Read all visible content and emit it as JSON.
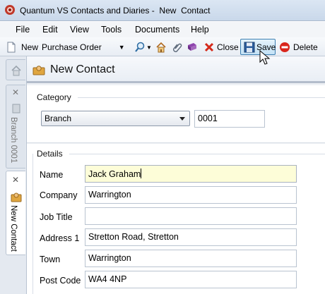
{
  "window": {
    "title": "Quantum VS Contacts and Diaries -  New  Contact"
  },
  "menu": {
    "file": "File",
    "edit": "Edit",
    "view": "View",
    "tools": "Tools",
    "documents": "Documents",
    "help": "Help"
  },
  "toolbar": {
    "new_label": "New",
    "purchase_order": "Purchase Order",
    "close_label": "Close",
    "save_label": "Save",
    "delete_label": "Delete"
  },
  "tabs": [
    {
      "label": "Branch 0001"
    },
    {
      "label": "New Contact"
    }
  ],
  "header": {
    "title": "New Contact"
  },
  "category": {
    "section_label": "Category",
    "dropdown_value": "Branch",
    "code_value": "0001"
  },
  "details": {
    "section_label": "Details",
    "fields": [
      {
        "label": "Name",
        "value": "Jack Graham"
      },
      {
        "label": "Company",
        "value": "Warrington"
      },
      {
        "label": "Job Title",
        "value": ""
      },
      {
        "label": "Address 1",
        "value": "Stretton Road, Stretton"
      },
      {
        "label": "Town",
        "value": "Warrington"
      },
      {
        "label": "Post Code",
        "value": "WA4 4NP"
      }
    ]
  },
  "colors": {
    "focused_field": "#fdfdd8",
    "save_highlight": "#c4e2f6",
    "close_icon": "#d42a1a",
    "delete_icon": "#d9261c"
  }
}
